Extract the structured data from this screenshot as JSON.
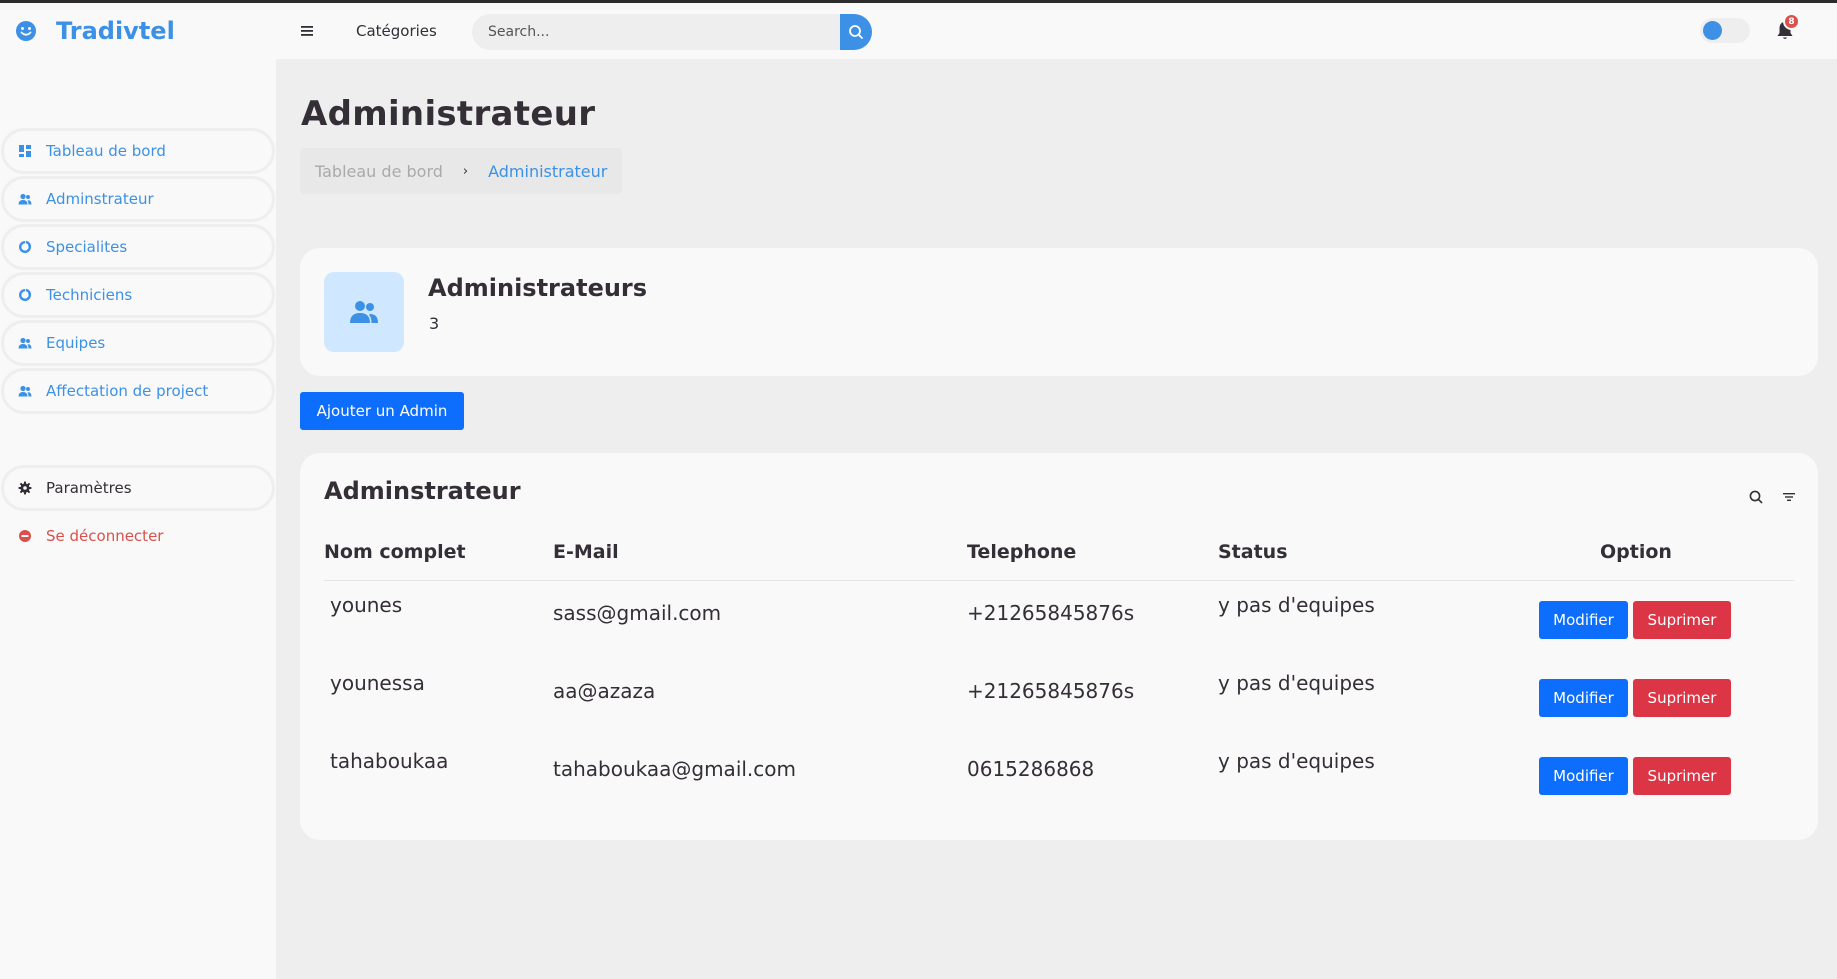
{
  "app": {
    "brand": "Tradivtel"
  },
  "topnav": {
    "categories_label": "Catégories",
    "search_placeholder": "Search...",
    "notification_count": "8",
    "theme_toggle_on": false
  },
  "sidebar": {
    "items": [
      {
        "label": "Tableau de bord",
        "icon": "dashboard-icon"
      },
      {
        "label": "Adminstrateur",
        "icon": "users-icon"
      },
      {
        "label": "Specialites",
        "icon": "donut-chart-icon"
      },
      {
        "label": "Techniciens",
        "icon": "donut-chart-icon"
      },
      {
        "label": "Equipes",
        "icon": "users-icon"
      },
      {
        "label": "Affectation de project",
        "icon": "users-icon"
      }
    ],
    "settings_label": "Paramètres",
    "logout_label": "Se déconnecter"
  },
  "main": {
    "title": "Administrateur",
    "breadcrumb": [
      "Tableau de bord",
      "Administrateur"
    ],
    "stat": {
      "title": "Administrateurs",
      "value": "3"
    },
    "add_button": "Ajouter un Admin",
    "table": {
      "heading": "Adminstrateur",
      "columns": [
        "Nom complet",
        "E-Mail",
        "Telephone",
        "Status",
        "Option"
      ],
      "rows": [
        {
          "name": "younes",
          "email": "sass@gmail.com",
          "phone": "+21265845876s",
          "status": "y pas d'equipes"
        },
        {
          "name": "younessa",
          "email": "aa@azaza",
          "phone": "+21265845876s",
          "status": "y pas d'equipes"
        },
        {
          "name": "tahaboukaa",
          "email": "tahaboukaa@gmail.com",
          "phone": "0615286868",
          "status": "y pas d'equipes"
        }
      ],
      "edit_label": "Modifier",
      "delete_label": "Suprimer"
    }
  },
  "colors": {
    "accent": "#3c91e6",
    "danger": "#db504a",
    "button_primary": "#0d6efd",
    "button_danger": "#dc3545",
    "light_blue": "#cfe8ff"
  }
}
